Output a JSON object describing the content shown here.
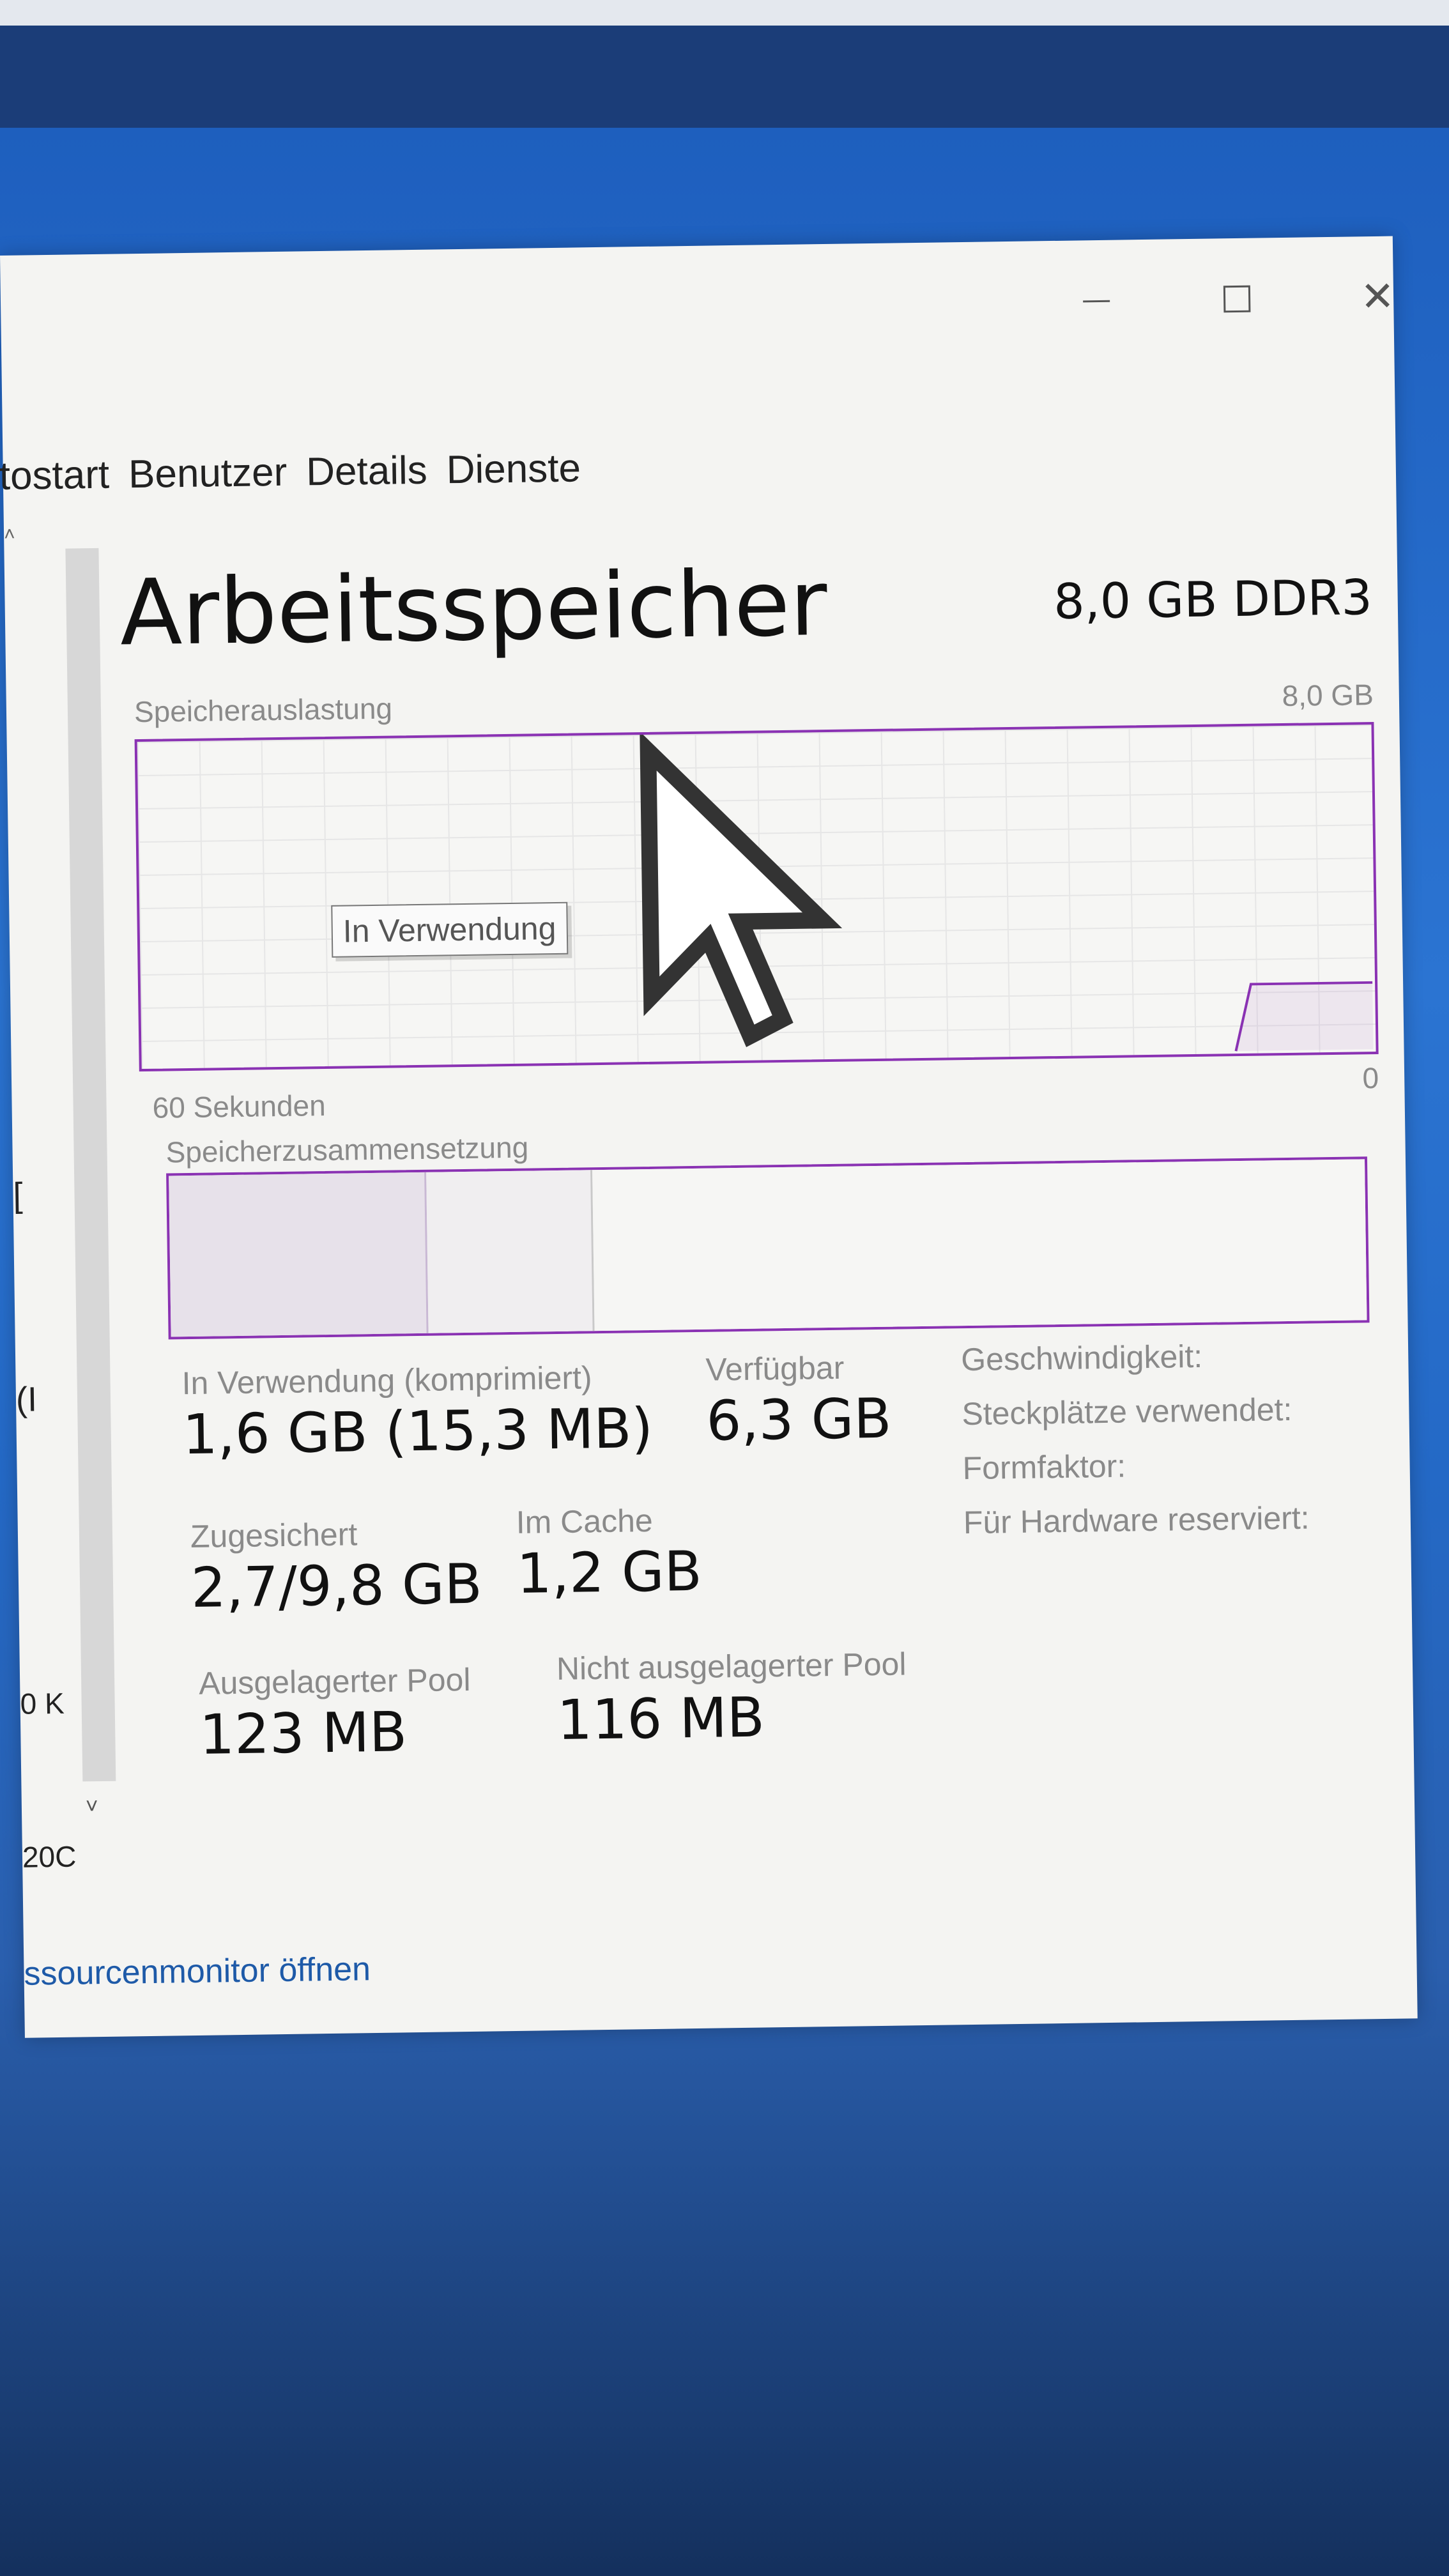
{
  "tabs": [
    "tostart",
    "Benutzer",
    "Details",
    "Dienste"
  ],
  "window": {
    "minimize_icon": "minimize-icon",
    "maximize_icon": "maximize-icon",
    "close_icon": "close-icon",
    "close_glyph": "✕"
  },
  "side_fragments": [
    "[",
    "(I",
    "0 K",
    "20C"
  ],
  "memory": {
    "title": "Arbeitsspeicher",
    "spec": "8,0 GB DDR3",
    "usage_label": "Speicherauslastung",
    "usage_max": "8,0 GB",
    "time_span": "60 Sekunden",
    "axis_min": "0",
    "tooltip": "In Verwendung",
    "composition_label": "Speicherzusammensetzung"
  },
  "stats": {
    "in_use_label": "In Verwendung (komprimiert)",
    "in_use_value": "1,6 GB (15,3 MB)",
    "available_label": "Verfügbar",
    "available_value": "6,3 GB",
    "committed_label": "Zugesichert",
    "committed_value": "2,7/9,8 GB",
    "cached_label": "Im Cache",
    "cached_value": "1,2 GB",
    "paged_label": "Ausgelagerter Pool",
    "paged_value": "123 MB",
    "nonpaged_label": "Nicht ausgelagerter Pool",
    "nonpaged_value": "116 MB",
    "speed_label": "Geschwindigkeit:",
    "slots_label": "Steckplätze verwendet:",
    "form_label": "Formfaktor:",
    "reserved_label": "Für Hardware reserviert:"
  },
  "footer": {
    "resource_monitor_link": "ssourcenmonitor öffnen"
  },
  "colors": {
    "accent": "#8a32b3",
    "link": "#1e5aa8"
  }
}
